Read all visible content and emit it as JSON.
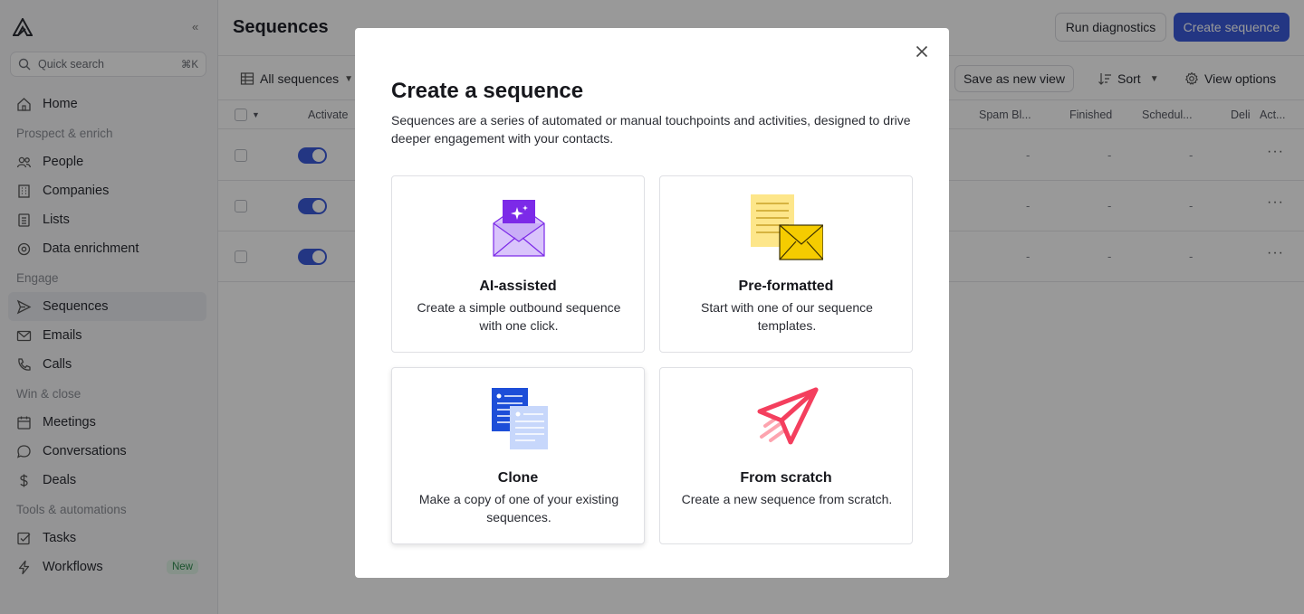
{
  "sidebar": {
    "search_placeholder": "Quick search",
    "search_shortcut": "⌘K",
    "collapse_label": "«",
    "home": "Home",
    "section_prospect": "Prospect & enrich",
    "people": "People",
    "companies": "Companies",
    "lists": "Lists",
    "data_enrichment": "Data enrichment",
    "section_engage": "Engage",
    "sequences": "Sequences",
    "emails": "Emails",
    "calls": "Calls",
    "section_win": "Win & close",
    "meetings": "Meetings",
    "conversations": "Conversations",
    "deals": "Deals",
    "section_tools": "Tools & automations",
    "tasks": "Tasks",
    "workflows": "Workflows",
    "workflows_badge": "New"
  },
  "header": {
    "title": "Sequences",
    "run_diagnostics": "Run diagnostics",
    "create_sequence": "Create sequence"
  },
  "toolbar": {
    "view_select": "All sequences",
    "save_view": "Save as new view",
    "sort": "Sort",
    "view_options": "View options"
  },
  "table": {
    "columns": [
      "Activate",
      "Spam Bl...",
      "Finished",
      "Schedul...",
      "Deli",
      "Act..."
    ],
    "empty_value": "-",
    "more": "···"
  },
  "modal": {
    "title": "Create a sequence",
    "description": "Sequences are a series of automated or manual touchpoints and activities, designed to drive deeper engagement with your contacts.",
    "cards": [
      {
        "title": "AI-assisted",
        "description": "Create a simple outbound sequence with one click."
      },
      {
        "title": "Pre-formatted",
        "description": "Start with one of our sequence templates."
      },
      {
        "title": "Clone",
        "description": "Make a copy of one of your existing sequences."
      },
      {
        "title": "From scratch",
        "description": "Create a new sequence from scratch."
      }
    ]
  },
  "colors": {
    "accent": "#3b5bdb",
    "ai_purple": "#7c2ae8",
    "note_yellow": "#fde68a",
    "envelope_yellow": "#f5cc00",
    "clone_blue": "#1d4ed8",
    "scratch_pink": "#f43f5e"
  }
}
